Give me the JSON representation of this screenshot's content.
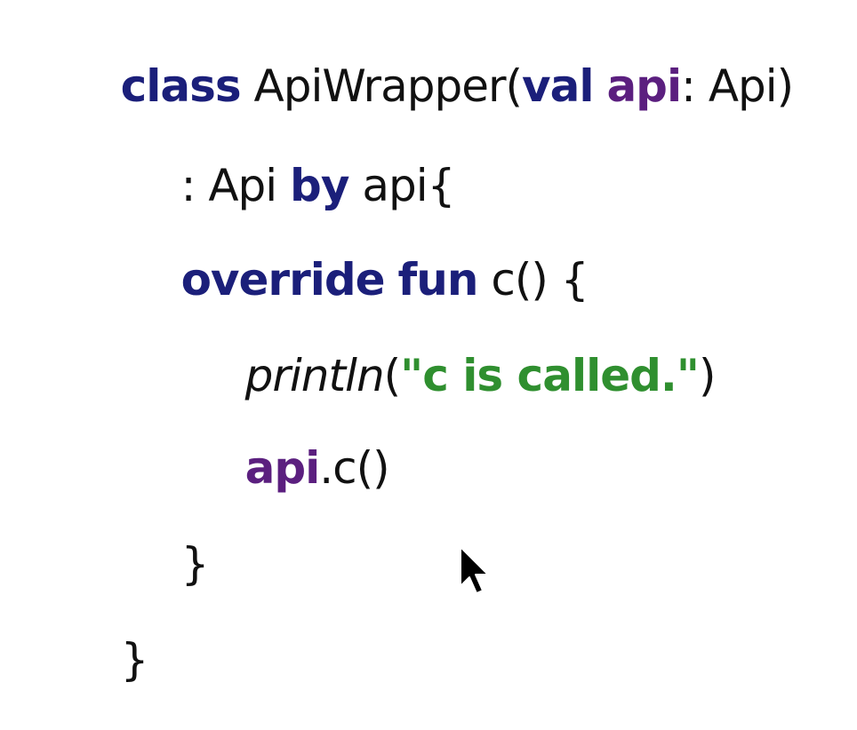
{
  "colors": {
    "background": "#ffffff",
    "keyword": "#1b1f7a",
    "property": "#5b1f7f",
    "string": "#2f8f2f",
    "plain": "#111111"
  },
  "code": {
    "line1": {
      "kw_class": "class",
      "name": " ApiWrapper(",
      "kw_val": "val",
      "space": " ",
      "prop_api": "api",
      "rest": ": Api)"
    },
    "line2": {
      "prefix": ": Api ",
      "kw_by": "by",
      "rest": " api{"
    },
    "line3": {
      "kw_override": "override",
      "space": " ",
      "kw_fun": "fun",
      "rest": " c() {"
    },
    "line4": {
      "fn_println": "println",
      "open": "(",
      "string": "\"c is called.\"",
      "close": ")"
    },
    "line5": {
      "prop_api": "api",
      "rest": ".c()"
    },
    "line6": {
      "brace": "}"
    },
    "line7": {
      "brace": "}"
    }
  },
  "cursor": {
    "icon": "mouse-pointer-icon"
  }
}
